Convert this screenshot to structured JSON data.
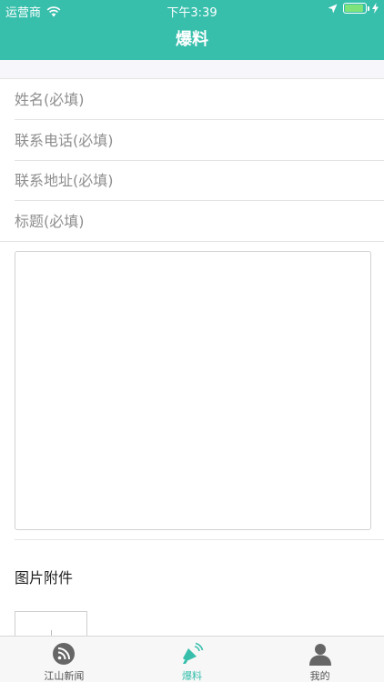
{
  "status_bar": {
    "carrier": "运营商",
    "time": "下午3:39"
  },
  "header": {
    "title": "爆料"
  },
  "form": {
    "fields": [
      {
        "placeholder": "姓名(必填)"
      },
      {
        "placeholder": "联系电话(必填)"
      },
      {
        "placeholder": "联系地址(必填)"
      },
      {
        "placeholder": "标题(必填)"
      }
    ],
    "content_placeholder": ""
  },
  "attachments": {
    "title": "图片附件"
  },
  "tab_bar": {
    "items": [
      {
        "label": "江山新闻",
        "icon": "rss-icon"
      },
      {
        "label": "爆料",
        "icon": "megaphone-icon"
      },
      {
        "label": "我的",
        "icon": "user-icon"
      }
    ],
    "active_index": 1
  },
  "colors": {
    "brand": "#37bfac",
    "battery": "#7ee37a"
  }
}
